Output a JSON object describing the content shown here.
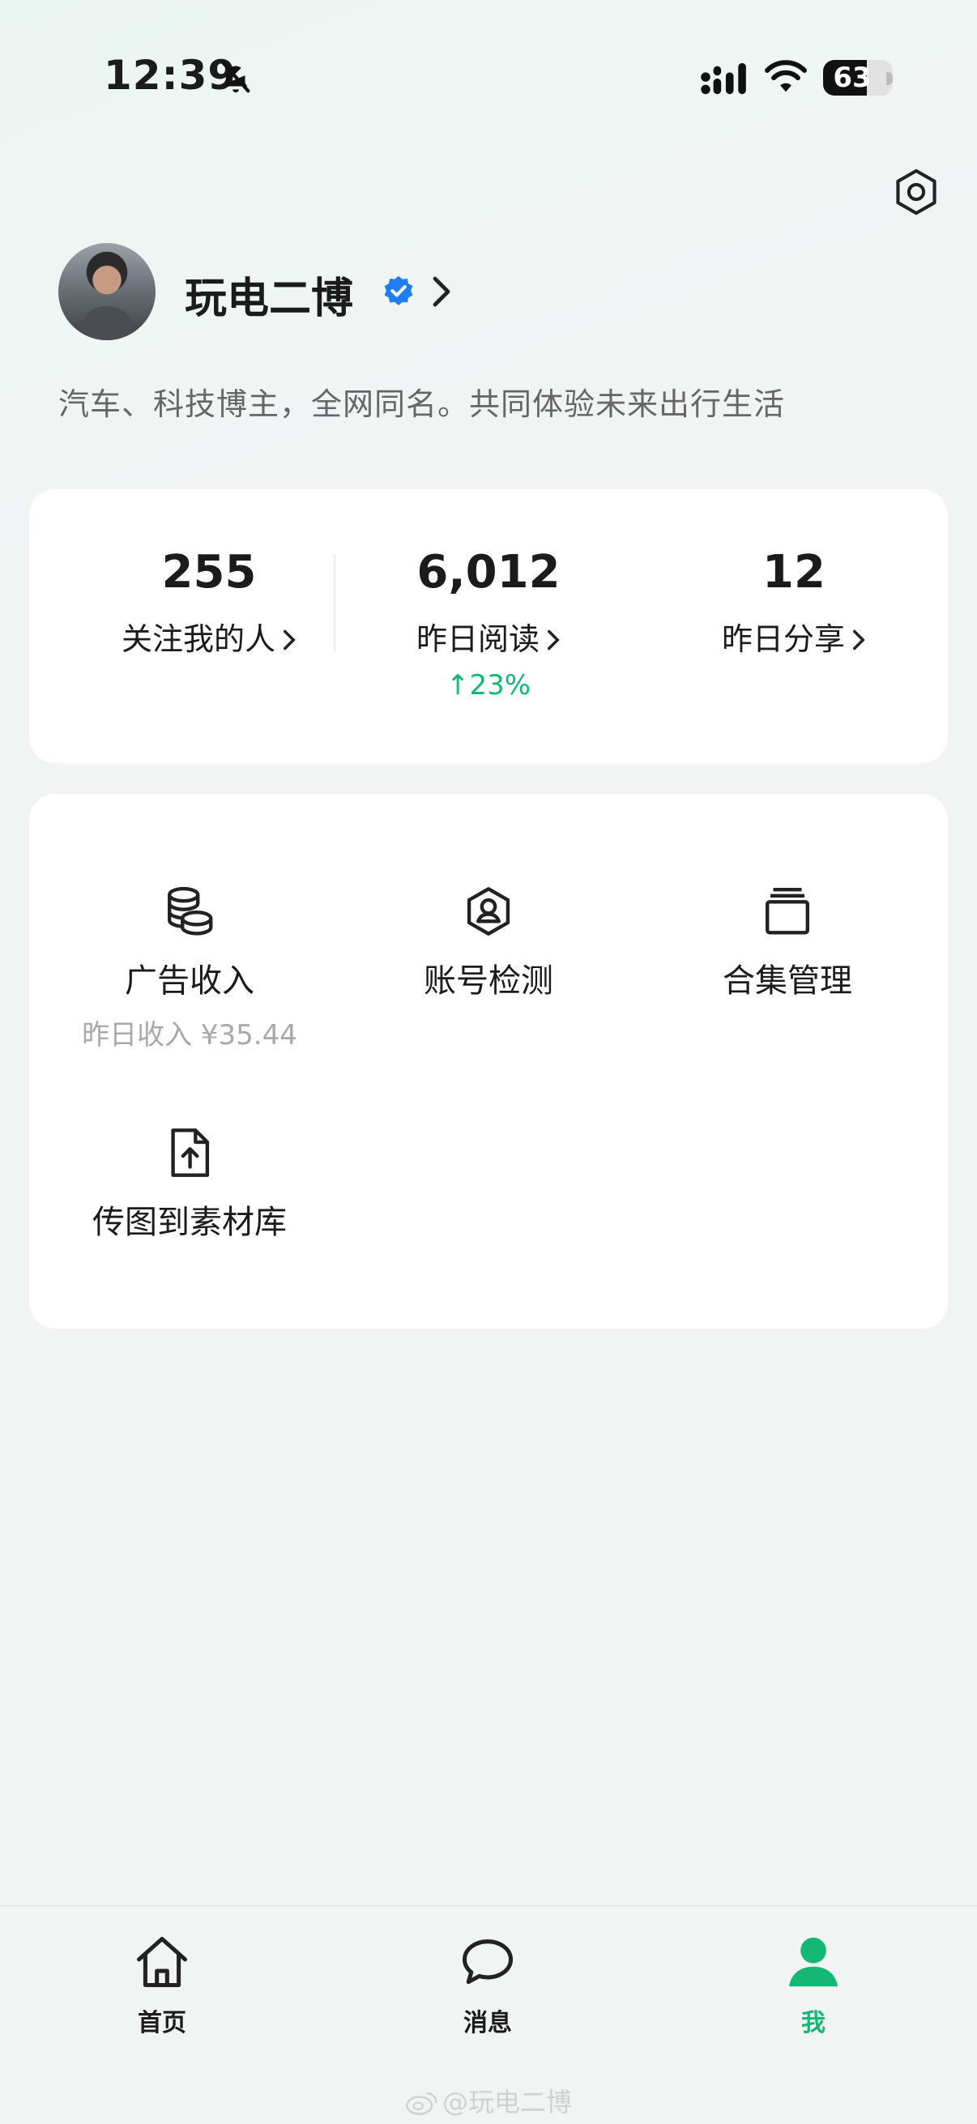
{
  "status_bar": {
    "time": "12:39",
    "battery": "63",
    "battery_level_percent": 63,
    "icons": [
      "bell-off-icon",
      "signal-icon",
      "wifi-icon",
      "battery-icon"
    ]
  },
  "header": {
    "settings_icon": "hexagon-settings-icon"
  },
  "profile": {
    "name": "玩电二博",
    "verified_icon": "verified-badge-icon",
    "bio": "汽车、科技博主，全网同名。共同体验未来出行生活"
  },
  "stats": [
    {
      "value": "255",
      "label": "关注我的人"
    },
    {
      "value": "6,012",
      "label": "昨日阅读",
      "delta": "↑23%"
    },
    {
      "value": "12",
      "label": "昨日分享"
    }
  ],
  "tools": [
    {
      "label": "广告收入",
      "sub": "昨日收入 ¥35.44",
      "icon": "coins-icon"
    },
    {
      "label": "账号检测",
      "icon": "account-check-icon"
    },
    {
      "label": "合集管理",
      "icon": "collection-icon"
    },
    {
      "label": "传图到素材库",
      "icon": "upload-file-icon"
    }
  ],
  "bottom_nav": [
    {
      "label": "首页",
      "icon": "home-icon",
      "active": false
    },
    {
      "label": "消息",
      "icon": "message-icon",
      "active": false
    },
    {
      "label": "我",
      "icon": "user-icon",
      "active": true
    }
  ],
  "watermark": "@玩电二博",
  "colors": {
    "accent": "#13b874",
    "verified": "#1f7ef6",
    "background": "#f2f4f4",
    "card": "#ffffff"
  }
}
